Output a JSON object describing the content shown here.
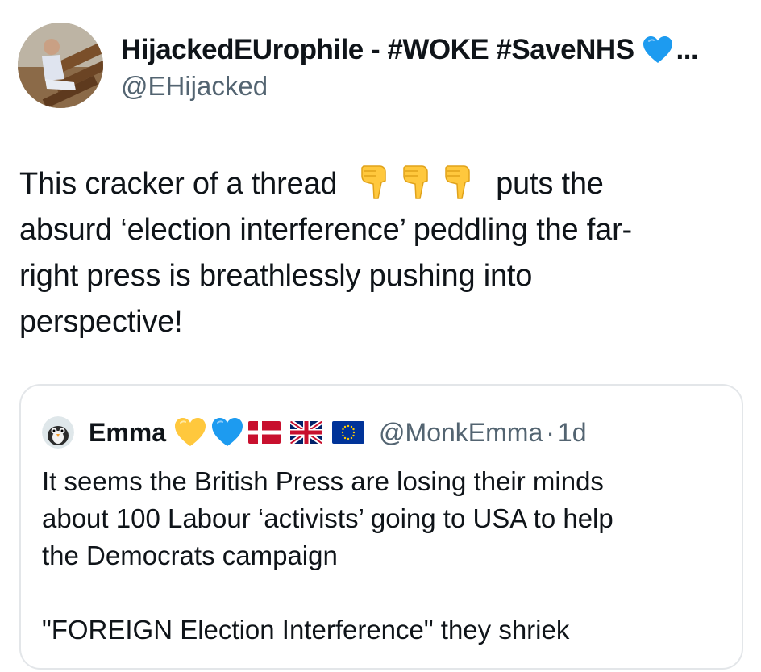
{
  "author": {
    "display_name": "HijackedEUrophile - #WOKE #SaveNHS",
    "name_emoji": "blue-heart-icon",
    "truncation": "...",
    "handle": "@EHijacked"
  },
  "tweet": {
    "lines": [
      {
        "before": "This cracker of a thread",
        "after": "puts the"
      },
      "absurd ‘election interference’ peddling the far-",
      "right press is breathlessly pushing into",
      "perspective!"
    ],
    "emoji": [
      "pointing-down-icon",
      "pointing-down-icon",
      "pointing-down-icon"
    ]
  },
  "quoted": {
    "name": "Emma",
    "emoji": [
      "yellow-heart-icon",
      "blue-heart-icon",
      "denmark-flag-icon",
      "uk-flag-icon",
      "eu-flag-icon"
    ],
    "handle": "@MonkEmma",
    "separator": "·",
    "time": "1d",
    "lines": [
      "It seems the British Press are losing their minds",
      "about 100 Labour ‘activists’ going to USA to help",
      "the Democrats campaign",
      "",
      "\"FOREIGN Election Interference\" they shriek"
    ]
  },
  "colors": {
    "text": "#0f1419",
    "secondary": "#536471",
    "border": "#e3e6e9",
    "blue_heart": "#1d9bf0",
    "yellow_heart": "#ffc83d"
  }
}
